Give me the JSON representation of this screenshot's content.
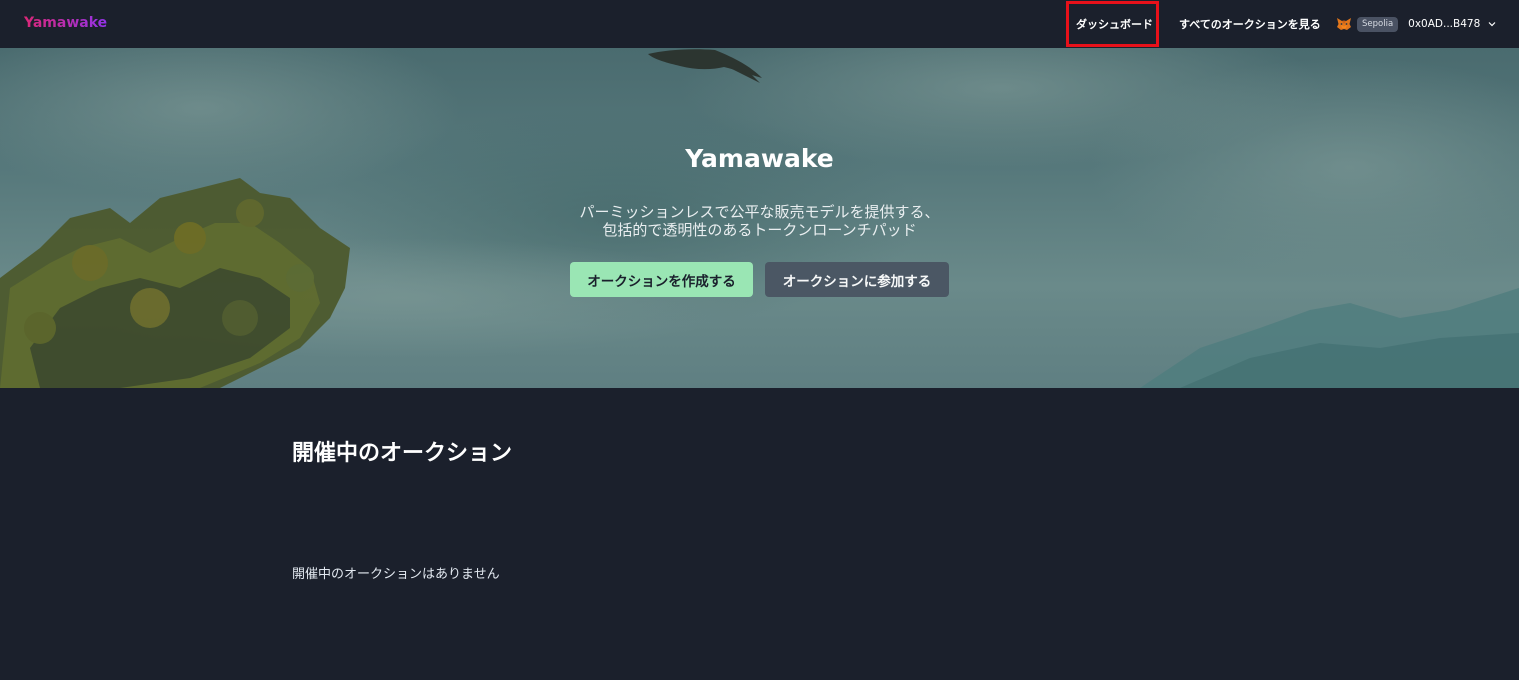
{
  "nav": {
    "logo": "Yamawake",
    "dashboard": "ダッシュボード",
    "all_auctions": "すべてのオークションを見る",
    "network": "Sepolia",
    "address": "0x0AD...B478"
  },
  "hero": {
    "title": "Yamawake",
    "subtitle_line1": "パーミッションレスで公平な販売モデルを提供する、",
    "subtitle_line2": "包括的で透明性のあるトークンローンチパッド",
    "create_button": "オークションを作成する",
    "join_button": "オークションに参加する"
  },
  "auctions": {
    "heading": "開催中のオークション",
    "empty_message": "開催中のオークションはありません"
  },
  "colors": {
    "background": "#1b202c",
    "primary_button": "#9ae6b4",
    "secondary_button": "#4a5563",
    "highlight": "#e8111a"
  }
}
